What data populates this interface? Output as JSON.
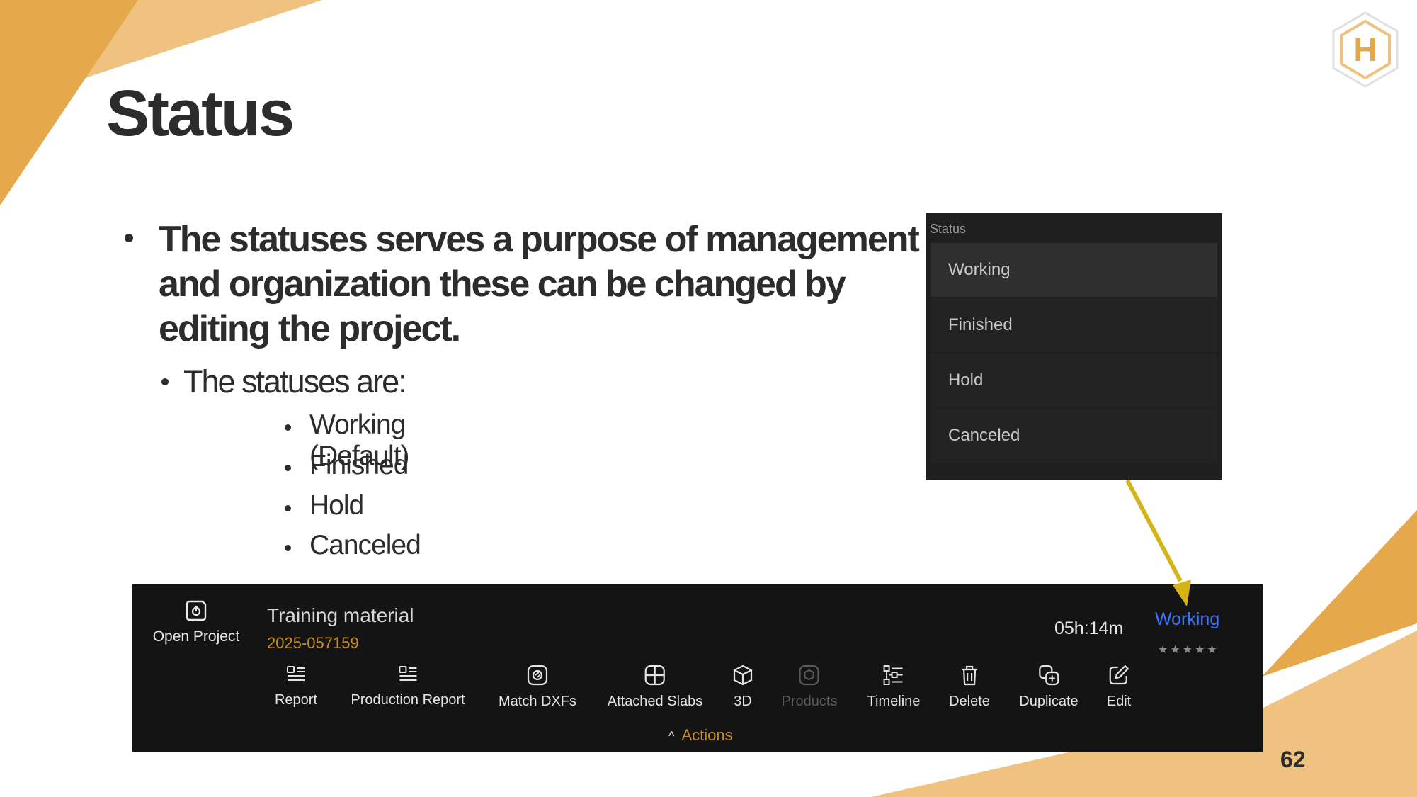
{
  "slide": {
    "title": "Status",
    "bullet_main": "The statuses serves a purpose of management and organization these can be changed by editing the project.",
    "bullet_sub": "The statuses are:",
    "statuses": [
      "Working (Default)",
      "Finished",
      "Hold",
      "Canceled"
    ],
    "page_number": "62"
  },
  "logo": {
    "letter": "H",
    "icon": "hexagon-h-logo"
  },
  "dropdown": {
    "header": "Status",
    "options": [
      "Working",
      "Finished",
      "Hold",
      "Canceled"
    ],
    "selected": "Working"
  },
  "panel": {
    "open_project_label": "Open Project",
    "project_name": "Training material",
    "project_number": "2025-057159",
    "timer": "05h:14m",
    "status": "Working",
    "rating_stars": "★★★★★",
    "rating_value": 0,
    "actions": [
      {
        "label": "Report",
        "icon": "report-icon",
        "enabled": true
      },
      {
        "label": "Production Report",
        "icon": "production-report-icon",
        "enabled": true
      },
      {
        "label": "Match DXFs",
        "icon": "match-dxfs-icon",
        "enabled": true
      },
      {
        "label": "Attached Slabs",
        "icon": "attached-slabs-icon",
        "enabled": true
      },
      {
        "label": "3D",
        "icon": "cube-icon",
        "enabled": true
      },
      {
        "label": "Products",
        "icon": "products-icon",
        "enabled": false
      },
      {
        "label": "Timeline",
        "icon": "timeline-icon",
        "enabled": true
      },
      {
        "label": "Delete",
        "icon": "trash-icon",
        "enabled": true
      },
      {
        "label": "Duplicate",
        "icon": "duplicate-icon",
        "enabled": true
      },
      {
        "label": "Edit",
        "icon": "edit-icon",
        "enabled": true
      }
    ],
    "actions_toggle": "Actions"
  },
  "colors": {
    "accent_gold": "#e5a84a",
    "accent_light": "#efc27f",
    "status_blue": "#3b74ff",
    "project_number": "#c78d1e",
    "arrow": "#d4b417"
  }
}
